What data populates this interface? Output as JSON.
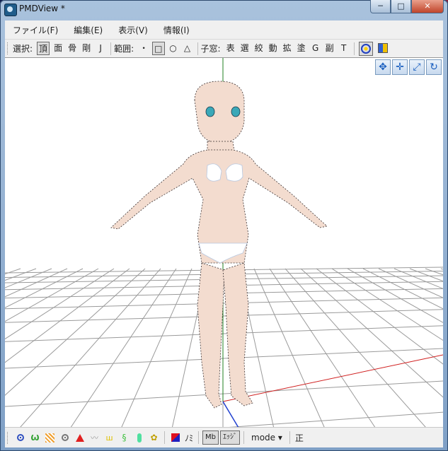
{
  "window": {
    "title": "PMDView *",
    "min": "─",
    "max": "□",
    "close": "✕"
  },
  "menu": [
    "ファイル(F)",
    "編集(E)",
    "表示(V)",
    "情報(I)"
  ],
  "toolbar": {
    "select_label": "選択:",
    "select_items": [
      "頂",
      "面",
      "骨",
      "剛",
      "J"
    ],
    "range_label": "範囲:",
    "range_items": [
      "・",
      "□",
      "○",
      "△"
    ],
    "child_label": "子窓:",
    "child_items": [
      "表",
      "選",
      "絞",
      "動",
      "拡",
      "塗",
      "G",
      "副",
      "T"
    ]
  },
  "statusbar": {
    "noumi": "ﾉﾐ",
    "md_label": "Mb",
    "edge_label": "ｴｯｼﾞ",
    "mode_label": "mode",
    "mode_arrow": "▾",
    "right_label": "正"
  },
  "colors": {
    "accent": "#2040c0",
    "grid": "#9a9a9a",
    "x_axis": "#d02020",
    "y_axis": "#208020",
    "z_axis": "#2040d0"
  }
}
